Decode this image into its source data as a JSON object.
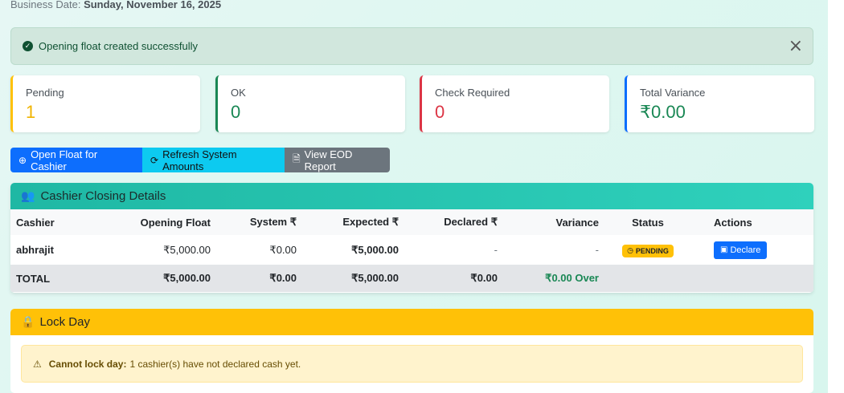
{
  "header": {
    "business_date_label": "Business Date:",
    "business_date_value": "Sunday, November 16, 2025"
  },
  "success_alert": {
    "icon": "check-circle-icon",
    "message": "Opening float created successfully",
    "close_icon": "×"
  },
  "stats": [
    {
      "label": "Pending",
      "value": "1",
      "color": "#f0b400",
      "border": "#ffc107"
    },
    {
      "label": "OK",
      "value": "0",
      "color": "#198754",
      "border": "#198754"
    },
    {
      "label": "Check Required",
      "value": "0",
      "color": "#dc3545",
      "border": "#dc3545"
    },
    {
      "label": "Total Variance",
      "value": "₹0.00",
      "color": "#198754",
      "border": "#0d6efd"
    }
  ],
  "actions": {
    "open_float": "Open Float for Cashier",
    "refresh": "Refresh System Amounts",
    "eod_report": "View EOD Report"
  },
  "cashier_panel": {
    "title": "Cashier Closing Details",
    "columns": [
      "Cashier",
      "Opening Float",
      "System ₹",
      "Expected ₹",
      "Declared ₹",
      "Variance",
      "Status",
      "Actions"
    ],
    "rows": [
      {
        "cashier": "abhrajit",
        "opening_float": "₹5,000.00",
        "system": "₹0.00",
        "expected": "₹5,000.00",
        "declared": "-",
        "variance": "-",
        "status": "PENDING",
        "action": "Declare"
      }
    ],
    "total": {
      "label": "TOTAL",
      "opening_float": "₹5,000.00",
      "system": "₹0.00",
      "expected": "₹5,000.00",
      "declared": "₹0.00",
      "variance": "₹0.00 Over"
    }
  },
  "lock_panel": {
    "title": "Lock Day",
    "warning_bold": "Cannot lock day:",
    "warning_text": "1 cashier(s) have not declared cash yet."
  }
}
